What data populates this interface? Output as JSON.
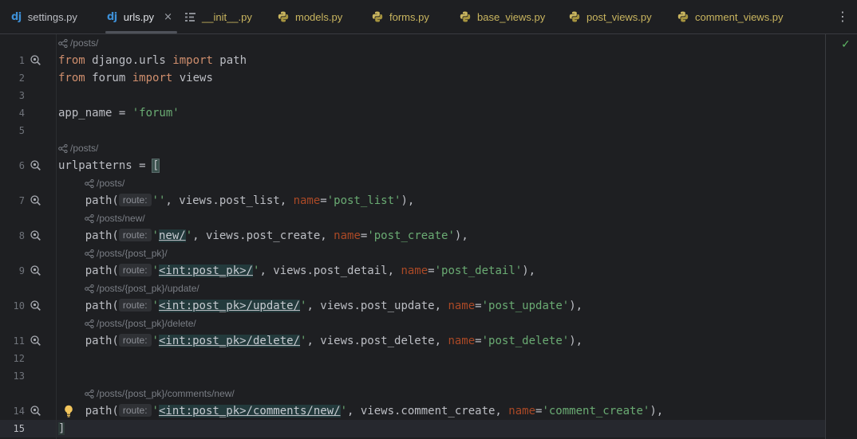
{
  "tabs": [
    {
      "label": "settings.py",
      "icon": "django-icon",
      "icon_text": "dj",
      "active": false
    },
    {
      "label": "urls.py",
      "icon": "django-icon",
      "icon_text": "dj",
      "active": true,
      "close": "×"
    },
    {
      "label": "__init__.py",
      "icon": "init-file-icon",
      "active": false
    },
    {
      "label": "models.py",
      "icon": "python-icon",
      "active": false
    },
    {
      "label": "forms.py",
      "icon": "python-icon",
      "active": false
    },
    {
      "label": "base_views.py",
      "icon": "python-icon",
      "active": false
    },
    {
      "label": "post_views.py",
      "icon": "python-icon",
      "active": false
    },
    {
      "label": "comment_views.py",
      "icon": "python-icon",
      "active": false
    }
  ],
  "more_menu": "⋮",
  "status_check": "✓",
  "code": {
    "hint_url_0": "/posts/",
    "l1": {
      "num": "1",
      "kw1": "from",
      "t1": " django.urls ",
      "kw2": "import",
      "t2": " path"
    },
    "l2": {
      "num": "2",
      "kw1": "from",
      "t1": " forum ",
      "kw2": "import",
      "t2": " views"
    },
    "l3": {
      "num": "3"
    },
    "l4": {
      "num": "4",
      "t1": "app_name = ",
      "s1": "'forum'"
    },
    "l5": {
      "num": "5"
    },
    "hint_url_1": "/posts/",
    "l6": {
      "num": "6",
      "t1": "urlpatterns = ",
      "b": "["
    },
    "hint_url_2": "/posts/",
    "l7": {
      "num": "7",
      "t1": "    path(",
      "hint": "route:",
      "s1": "''",
      "t2": ", views.post_list, ",
      "p": "name",
      "t3": "=",
      "s2": "'post_list'",
      "t4": "),"
    },
    "hint_url_3": "/posts/new/",
    "l8": {
      "num": "8",
      "t1": "    path(",
      "hint": "route:",
      "q1": "'",
      "inj": "new/",
      "q2": "'",
      "t2": ", views.post_create, ",
      "p": "name",
      "t3": "=",
      "s2": "'post_create'",
      "t4": "),"
    },
    "hint_url_4": "/posts/{post_pk}/",
    "l9": {
      "num": "9",
      "t1": "    path(",
      "hint": "route:",
      "q1": "'",
      "inj": "<int:post_pk>/",
      "q2": "'",
      "t2": ", views.post_detail, ",
      "p": "name",
      "t3": "=",
      "s2": "'post_detail'",
      "t4": "),"
    },
    "hint_url_5": "/posts/{post_pk}/update/",
    "l10": {
      "num": "10",
      "t1": "    path(",
      "hint": "route:",
      "q1": "'",
      "inj": "<int:post_pk>/update/",
      "q2": "'",
      "t2": ", views.post_update, ",
      "p": "name",
      "t3": "=",
      "s2": "'post_update'",
      "t4": "),"
    },
    "hint_url_6": "/posts/{post_pk}/delete/",
    "l11": {
      "num": "11",
      "t1": "    path(",
      "hint": "route:",
      "q1": "'",
      "inj": "<int:post_pk>/delete/",
      "q2": "'",
      "t2": ", views.post_delete, ",
      "p": "name",
      "t3": "=",
      "s2": "'post_delete'",
      "t4": "),"
    },
    "l12": {
      "num": "12"
    },
    "l13": {
      "num": "13"
    },
    "hint_url_7": "/posts/{post_pk}/comments/new/",
    "l14": {
      "num": "14",
      "t1": "    path(",
      "hint": "route:",
      "q1": "'",
      "inj": "<int:post_pk>/comments/new/",
      "q2": "'",
      "t2": ", views.comment_create, ",
      "p": "name",
      "t3": "=",
      "s2": "'comment_create'",
      "t4": "),"
    },
    "l15": {
      "num": "15",
      "b": "]"
    }
  },
  "colors": {
    "background": "#1e1f22",
    "keyword": "#cf8e6d",
    "string": "#6aab73",
    "named_param": "#aa4926",
    "django_icon": "#3d8fd6",
    "python_tab_text": "#c9b55f",
    "check": "#5fb865"
  }
}
